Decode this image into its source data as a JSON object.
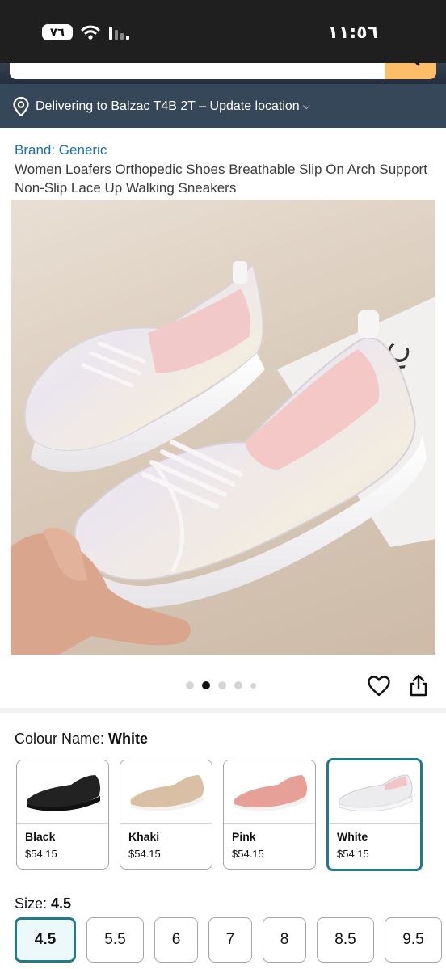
{
  "status": {
    "time": "١١:٥٦",
    "battery": "٧٦"
  },
  "delivery": {
    "text": "Delivering to Balzac T4B 2T – Update location"
  },
  "product": {
    "brand": "Brand: Generic",
    "title": "Women Loafers Orthopedic Shoes Breathable Slip On Arch Support Non-Slip Lace Up Walking Sneakers"
  },
  "carousel": {
    "count": 5,
    "active_index": 1
  },
  "colour": {
    "label": "Colour Name: ",
    "value": "White",
    "options": [
      {
        "name": "Black",
        "price": "$54.15",
        "color": "#222222"
      },
      {
        "name": "Khaki",
        "price": "$54.15",
        "color": "#d8bea3"
      },
      {
        "name": "Pink",
        "price": "$54.15",
        "color": "#e7a097"
      },
      {
        "name": "White",
        "price": "$54.15",
        "color": "#ecebee"
      }
    ],
    "selected_index": 3
  },
  "size": {
    "label": "Size: ",
    "value": "4.5",
    "options": [
      "4.5",
      "5.5",
      "6",
      "7",
      "8",
      "8.5",
      "9.5"
    ],
    "selected_index": 0
  },
  "colors": {
    "accent": "#1f7a8c",
    "header": "#37475a",
    "search_button": "#febd69",
    "link": "#1a6ea8"
  }
}
